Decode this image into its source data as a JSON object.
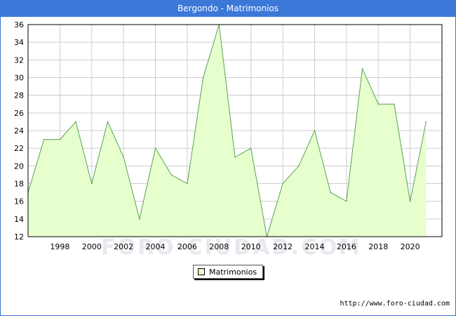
{
  "window": {
    "title": "Bergondo - Matrimonios"
  },
  "footer": {
    "credit": "http://www.foro-ciudad.com",
    "watermark": "FORO-CIUDAD.COM"
  },
  "colors": {
    "title_bar": "#3c78d8",
    "area_fill": "#e6ffcc",
    "area_line": "#5aa05a",
    "grid": "#cccccc"
  },
  "chart_data": {
    "type": "area",
    "title": "Bergondo - Matrimonios",
    "xlabel": "",
    "ylabel": "",
    "x": [
      1996,
      1997,
      1998,
      1999,
      2000,
      2001,
      2002,
      2003,
      2004,
      2005,
      2006,
      2007,
      2008,
      2009,
      2010,
      2011,
      2012,
      2013,
      2014,
      2015,
      2016,
      2017,
      2018,
      2019,
      2020,
      2021
    ],
    "series": [
      {
        "name": "Matrimonios",
        "values": [
          17,
          23,
          23,
          25,
          18,
          25,
          21,
          14,
          22,
          19,
          18,
          30,
          36,
          21,
          22,
          12,
          18,
          20,
          24,
          17,
          16,
          31,
          27,
          27,
          16,
          25
        ]
      }
    ],
    "xlim": [
      1996,
      2022
    ],
    "ylim": [
      12,
      36
    ],
    "xticks": [
      1998,
      2000,
      2002,
      2004,
      2006,
      2008,
      2010,
      2012,
      2014,
      2016,
      2018,
      2020
    ],
    "yticks": [
      12,
      14,
      16,
      18,
      20,
      22,
      24,
      26,
      28,
      30,
      32,
      34,
      36
    ],
    "grid": true,
    "legend_position": "bottom-center"
  }
}
